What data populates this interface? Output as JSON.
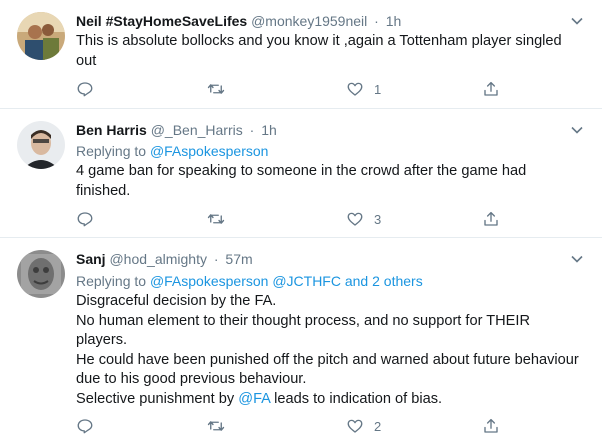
{
  "tweets": [
    {
      "name": "Neil #StayHomeSaveLifes",
      "handle": "@monkey1959neil",
      "separator": "·",
      "time": "1h",
      "replying_label": "",
      "replying_to": "",
      "body": [
        "This is absolute bollocks and you know it ,again a Tottenham player singled out"
      ],
      "like_count": "1",
      "reply_count": "",
      "retweet_count": ""
    },
    {
      "name": "Ben Harris",
      "handle": "@_Ben_Harris",
      "separator": "·",
      "time": "1h",
      "replying_label": "Replying to",
      "replying_to": "@FAspokesperson",
      "body": [
        "4 game ban for speaking to someone in the crowd after the game had finished."
      ],
      "like_count": "3",
      "reply_count": "",
      "retweet_count": ""
    },
    {
      "name": "Sanj",
      "handle": "@hod_almighty",
      "separator": "·",
      "time": "57m",
      "replying_label": "Replying to",
      "replying_to": "@FAspokesperson @JCTHFC and 2 others",
      "body_lines": [
        "Disgraceful decision by the FA.",
        "No human element to their thought process, and no support for THEIR players.",
        "He could have been punished off the pitch and warned about future behaviour due to his good previous behaviour."
      ],
      "last_line_pre": "Selective punishment by ",
      "last_line_mention": "@FA",
      "last_line_post": " leads to indication of bias.",
      "like_count": "2",
      "reply_count": "",
      "retweet_count": ""
    }
  ],
  "colors": {
    "accent": "#1b95e0",
    "secondary_text": "#657786",
    "divider": "#e6ecf0"
  },
  "icons": [
    "reply-icon",
    "retweet-icon",
    "like-icon",
    "share-icon",
    "chevron-down-icon"
  ]
}
